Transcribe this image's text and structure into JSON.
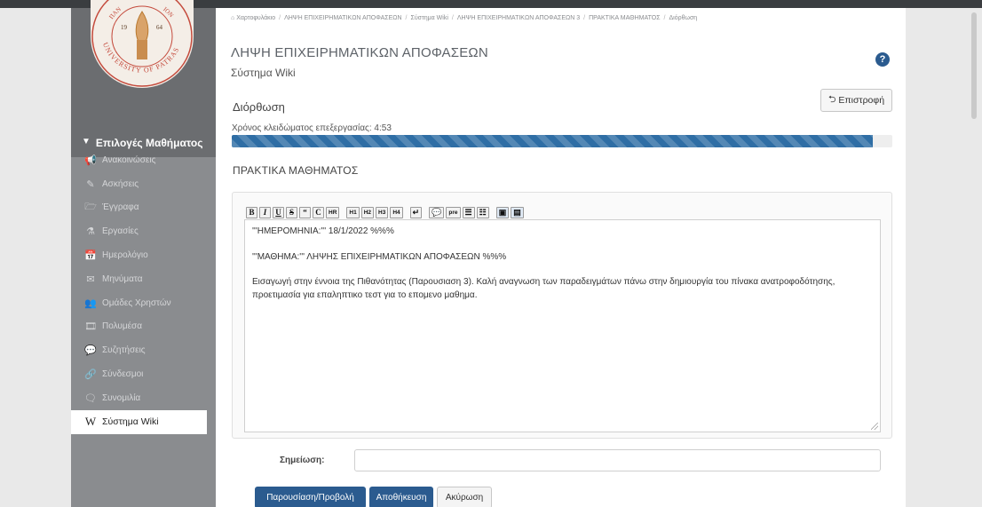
{
  "colors": {
    "primary": "#2b5b8f",
    "sidebar": "#8a8c8f",
    "sidebar_dark": "#6b6d70",
    "progress": "#2f6ea5"
  },
  "logo": {
    "name": "university-seal",
    "year_left": "19",
    "year_right": "64",
    "arc_top": "ΠΑΝ…ΙΟΝ",
    "arc_bottom": "UNIVERSITY OF PATRAS"
  },
  "breadcrumb": [
    "Χαρτοφυλάκιο",
    "ΛΗΨΗ ΕΠΙΧΕΙΡΗΜΑΤΙΚΩΝ ΑΠΟΦΑΣΕΩΝ",
    "Σύστημα Wiki",
    "ΛΗΨΗ ΕΠΙΧΕΙΡΗΜΑΤΙΚΩΝ ΑΠΟΦΑΣΕΩΝ 3",
    "ΠΡΑΚΤΙΚΑ ΜΑΘΗΜΑΤΟΣ",
    "Διόρθωση"
  ],
  "sidebar": {
    "header": "Επιλογές Μαθήματος",
    "items": [
      {
        "label": "Ανακοινώσεις",
        "icon": "bullhorn-icon",
        "glyph": "📢"
      },
      {
        "label": "Ασκήσεις",
        "icon": "pencil-icon",
        "glyph": "✎"
      },
      {
        "label": "Έγγραφα",
        "icon": "folder-icon",
        "glyph": "🗁"
      },
      {
        "label": "Εργασίες",
        "icon": "flask-icon",
        "glyph": "⚗"
      },
      {
        "label": "Ημερολόγιο",
        "icon": "calendar-icon",
        "glyph": "📅"
      },
      {
        "label": "Μηνύματα",
        "icon": "envelope-icon",
        "glyph": "✉"
      },
      {
        "label": "Ομάδες Χρηστών",
        "icon": "users-icon",
        "glyph": "👥"
      },
      {
        "label": "Πολυμέσα",
        "icon": "film-icon",
        "glyph": "🎞"
      },
      {
        "label": "Συζητήσεις",
        "icon": "comments-icon",
        "glyph": "💬"
      },
      {
        "label": "Σύνδεσμοι",
        "icon": "link-icon",
        "glyph": "🔗"
      },
      {
        "label": "Συνομιλία",
        "icon": "chat-icon",
        "glyph": "🗨"
      },
      {
        "label": "Σύστημα Wiki",
        "icon": "wikipedia-icon",
        "glyph": "W",
        "active": true
      }
    ]
  },
  "page": {
    "course_title": "ΛΗΨΗ ΕΠΙΧΕΙΡΗΜΑΤΙΚΩΝ ΑΠΟΦΑΣΕΩΝ",
    "subtitle": "Σύστημα Wiki",
    "help_glyph": "?",
    "heading": "Διόρθωση",
    "back_label": "Επιστροφή",
    "lock_text": "Χρόνος κλειδώματος επεξεργασίας: 4:53",
    "lock_progress": 0.97,
    "wiki_title": "ΠΡΑΚΤΙΚΑ ΜΑΘΗΜΑΤΟΣ"
  },
  "editor": {
    "toolbar": [
      {
        "name": "bold-button",
        "label": "B"
      },
      {
        "name": "italic-button",
        "label": "I"
      },
      {
        "name": "underline-button",
        "label": "U"
      },
      {
        "name": "strike-button",
        "label": "S"
      },
      {
        "name": "quote-button",
        "label": "“"
      },
      {
        "name": "code-button",
        "label": "C"
      },
      {
        "name": "hr-button",
        "label": "HR",
        "small": true
      },
      {
        "name": "h1-button",
        "label": "H1",
        "small": true,
        "gap": true
      },
      {
        "name": "h2-button",
        "label": "H2",
        "small": true
      },
      {
        "name": "h3-button",
        "label": "H3",
        "small": true
      },
      {
        "name": "h4-button",
        "label": "H4",
        "small": true
      },
      {
        "name": "linebreak-button",
        "label": "↵",
        "gap": true
      },
      {
        "name": "comment-button",
        "label": "💬",
        "gap": true
      },
      {
        "name": "pre-button",
        "label": "pre",
        "small": true
      },
      {
        "name": "bullet-list-button",
        "label": "☰"
      },
      {
        "name": "numbered-list-button",
        "label": "☷"
      },
      {
        "name": "image-button",
        "label": "▣",
        "gap": true,
        "blue": true
      },
      {
        "name": "file-button",
        "label": "▤",
        "blue": true
      }
    ],
    "content": [
      "'''ΗΜΕΡΟΜΗΝΙΑ:''' 18/1/2022 %%%",
      "'''ΜΑΘΗΜΑ:''' ΛΗΨΗΣ ΕΠΙΧΕΙΡΗΜΑΤΙΚΩΝ ΑΠΟΦΑΣΕΩΝ %%%",
      "Εισαγωγή στην έννοια της Πιθανότητας (Παρουσιαση 3). Καλή αναγνωση των παραδειγμάτων πάνω στην δημιουργία του πίνακα ανατροφοδότησης, προετιμασία για επαληπτικο τεστ για το επομενο μαθημα."
    ],
    "note_label": "Σημείωση:",
    "note_value": ""
  },
  "actions": {
    "present_label": "Παρουσίαση/Προβολή",
    "save_label": "Αποθήκευση",
    "cancel_label": "Ακύρωση"
  }
}
